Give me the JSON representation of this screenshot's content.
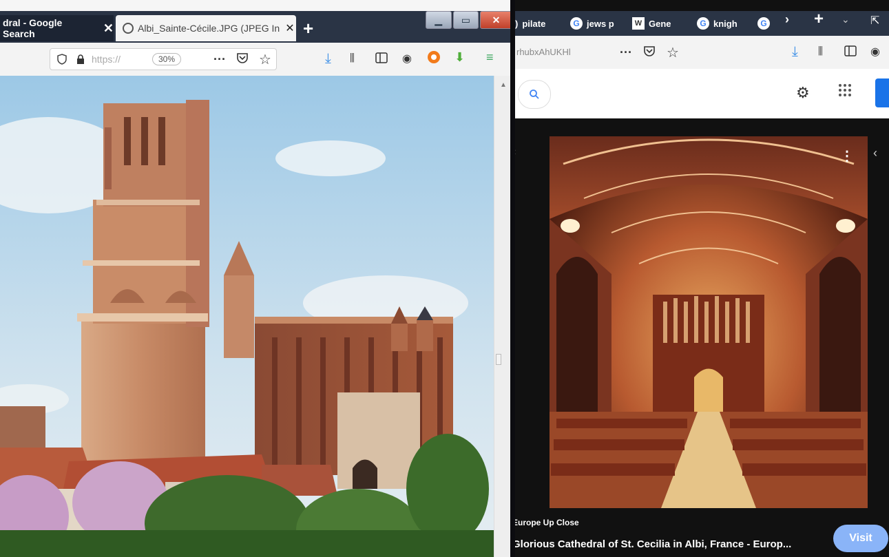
{
  "left_window": {
    "tabs": [
      {
        "label": "dral - Google Search",
        "close": "✕"
      },
      {
        "label": "Albi_Sainte-Cécile.JPG (JPEG In",
        "close": "✕"
      }
    ],
    "new_tab": "+",
    "url": "https://",
    "zoom": "30%",
    "more": "···"
  },
  "right_window": {
    "tabs": [
      {
        "label": "pilate",
        "favicon": "pilate-favicon"
      },
      {
        "label": "jews p",
        "favicon": "G"
      },
      {
        "label": "Gene",
        "favicon": "W"
      },
      {
        "label": "knigh",
        "favicon": "G"
      },
      {
        "label": "",
        "favicon": "G"
      }
    ],
    "url_fragment": "rhubxAhUKHl",
    "more": "···",
    "new_tab": "+",
    "source": "Europe Up Close",
    "caption": "Glorious Cathedral of St. Cecilia in Albi, France - Europ...",
    "visit_label": "Visit"
  },
  "colors": {
    "tab_bar": "#2a3445",
    "visit": "#8ab4f8",
    "google_blue": "#1a73e8"
  }
}
